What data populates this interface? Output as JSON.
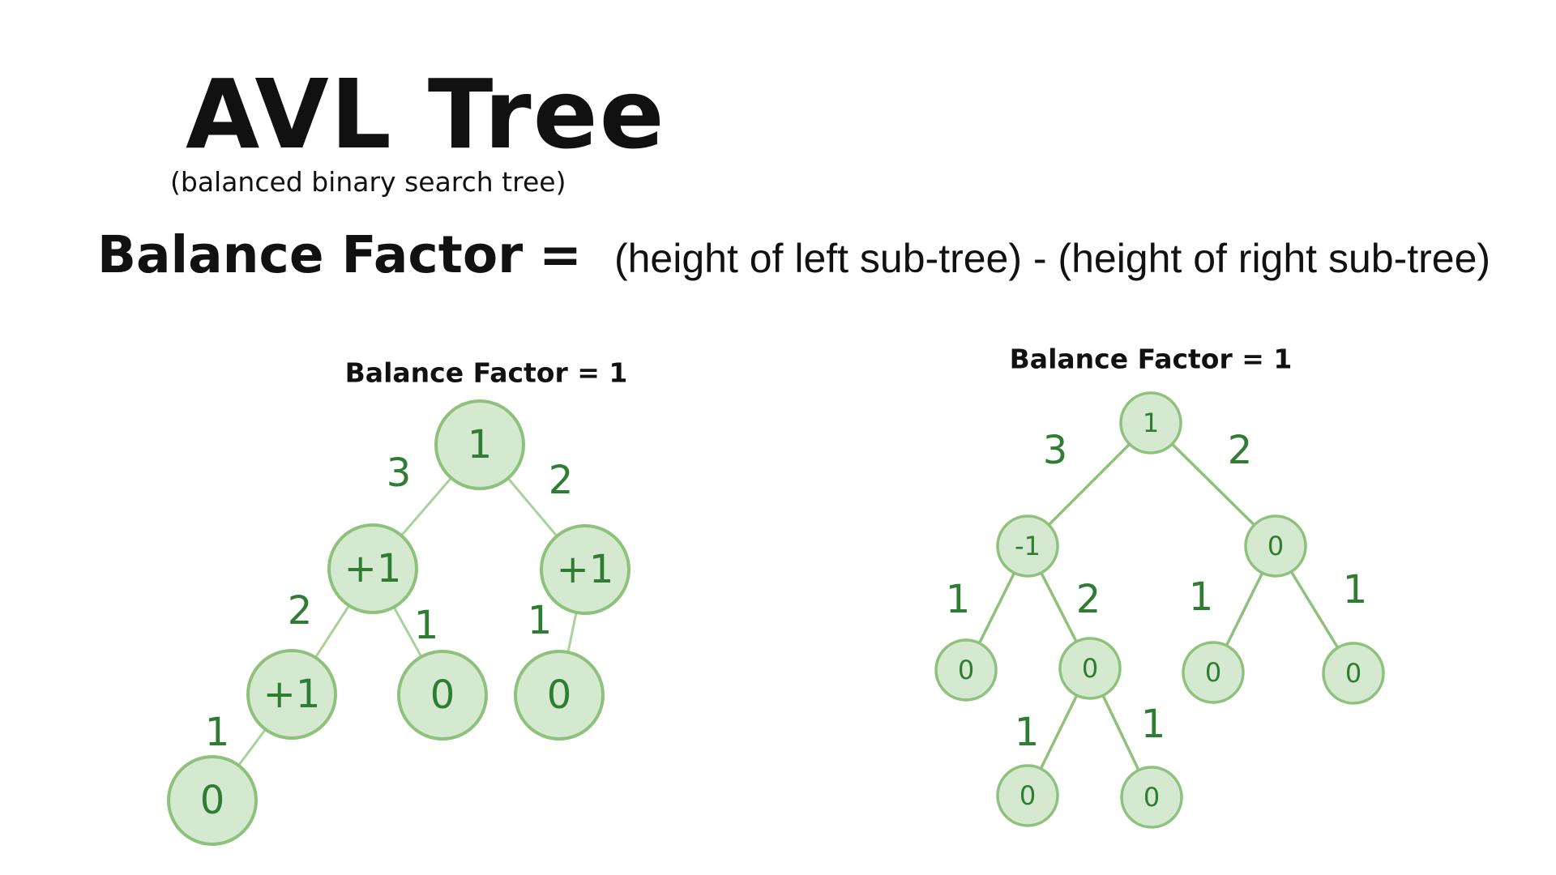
{
  "title": "AVL Tree",
  "subtitle": "(balanced binary search tree)",
  "formula": {
    "label": "Balance Factor",
    "equals": "=",
    "rhs": "(height of left sub-tree) - (height of right sub-tree)"
  },
  "colors": {
    "node_fill": "#d5e8d0",
    "node_stroke": "#8ec27c",
    "text_green": "#2e7d32",
    "text_dark": "#111111"
  },
  "trees": [
    {
      "title": "Balance Factor = 1",
      "nodes": [
        {
          "id": "A",
          "value": "1"
        },
        {
          "id": "B",
          "value": "+1"
        },
        {
          "id": "C",
          "value": "+1"
        },
        {
          "id": "D",
          "value": "+1"
        },
        {
          "id": "E",
          "value": "0"
        },
        {
          "id": "F",
          "value": "0"
        },
        {
          "id": "G",
          "value": "0"
        }
      ],
      "edges": [
        {
          "from": "A",
          "to": "B",
          "height": "3"
        },
        {
          "from": "A",
          "to": "C",
          "height": "2"
        },
        {
          "from": "B",
          "to": "D",
          "height": "2"
        },
        {
          "from": "B",
          "to": "E",
          "height": "1"
        },
        {
          "from": "C",
          "to": "F",
          "height": "1"
        },
        {
          "from": "D",
          "to": "G",
          "height": "1"
        }
      ]
    },
    {
      "title": "Balance Factor = 1",
      "nodes": [
        {
          "id": "A",
          "value": "1"
        },
        {
          "id": "B",
          "value": "-1"
        },
        {
          "id": "C",
          "value": "0"
        },
        {
          "id": "D",
          "value": "0"
        },
        {
          "id": "E",
          "value": "0"
        },
        {
          "id": "F",
          "value": "0"
        },
        {
          "id": "G",
          "value": "0"
        },
        {
          "id": "H",
          "value": "0"
        },
        {
          "id": "I",
          "value": "0"
        }
      ],
      "edges": [
        {
          "from": "A",
          "to": "B",
          "height": "3"
        },
        {
          "from": "A",
          "to": "C",
          "height": "2"
        },
        {
          "from": "B",
          "to": "D",
          "height": "1"
        },
        {
          "from": "B",
          "to": "E",
          "height": "2"
        },
        {
          "from": "C",
          "to": "F",
          "height": "1"
        },
        {
          "from": "C",
          "to": "G",
          "height": "1"
        },
        {
          "from": "E",
          "to": "H",
          "height": "1"
        },
        {
          "from": "E",
          "to": "I",
          "height": "1"
        }
      ]
    }
  ]
}
